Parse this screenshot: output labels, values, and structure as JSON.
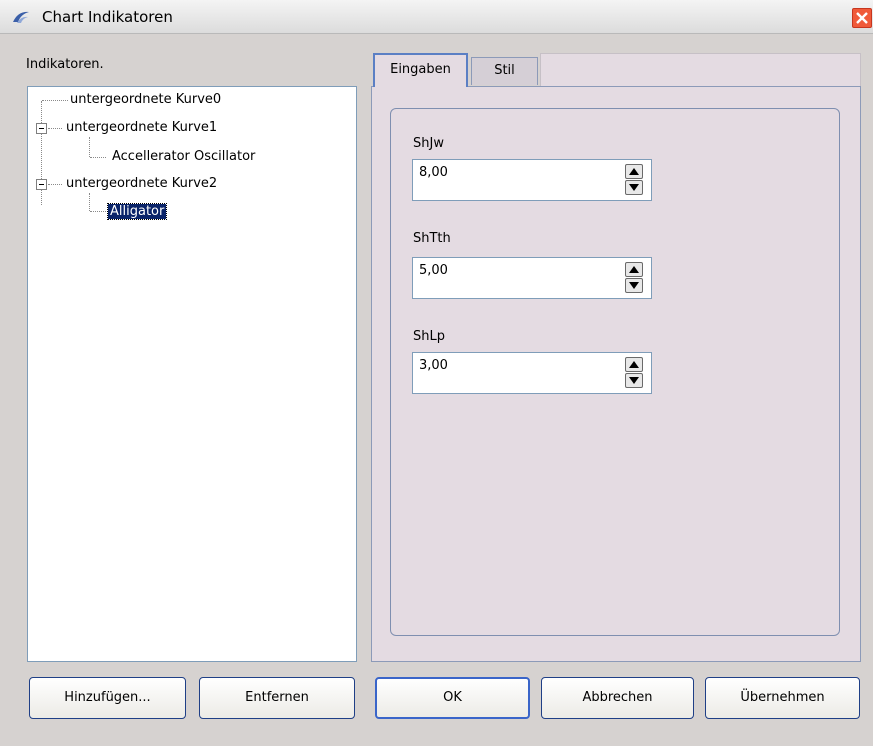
{
  "window": {
    "title": "Chart Indikatoren",
    "close_icon": "close-icon"
  },
  "left": {
    "label": "Indikatoren."
  },
  "tree": {
    "items": [
      {
        "label": "untergeordnete Kurve0"
      },
      {
        "label": "untergeordnete Kurve1"
      },
      {
        "label": "Accellerator Oscillator"
      },
      {
        "label": "untergeordnete Kurve2"
      },
      {
        "label": "Alligator"
      }
    ]
  },
  "tabs": [
    {
      "label": "Eingaben"
    },
    {
      "label": "Stil"
    }
  ],
  "inputs": [
    {
      "label": "ShJw",
      "value": "8,00"
    },
    {
      "label": "ShTth",
      "value": "5,00"
    },
    {
      "label": "ShLp",
      "value": "3,00"
    }
  ],
  "buttons": {
    "add": "Hinzufügen...",
    "remove": "Entfernen",
    "ok": "OK",
    "cancel": "Abbrechen",
    "apply": "Übernehmen"
  },
  "colors": {
    "selection": "#0a246a",
    "panel": "#e4dbe2",
    "close": "#f05a3a"
  }
}
